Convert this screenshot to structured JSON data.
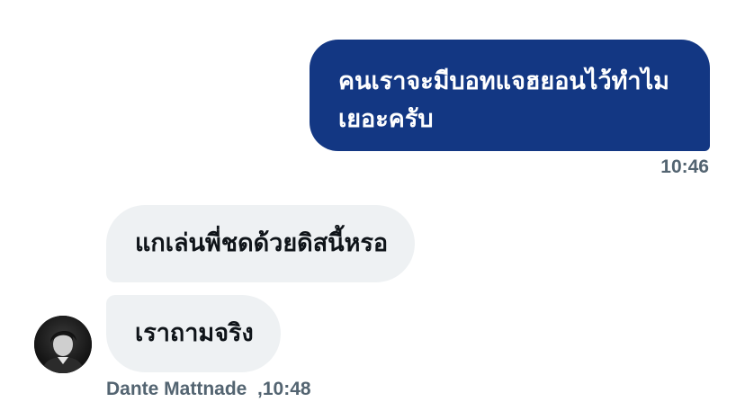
{
  "conversation": {
    "sent_message": {
      "text": "คนเราจะมีบอทแจฮยอนไว้ทำไมเยอะครับ",
      "time": "10:46"
    },
    "received_messages": [
      {
        "text": "แกเล่นพี่ชดด้วยดิสนี้หรอ"
      },
      {
        "text": "เราถามจริง"
      }
    ],
    "received_meta": {
      "sender": "Dante Mattnade",
      "time": "10:48"
    }
  },
  "colors": {
    "sent_bubble": "#133783",
    "received_bubble": "#eef1f3",
    "meta_text": "#536471"
  },
  "icons": {
    "avatar": "user-photo-avatar"
  }
}
